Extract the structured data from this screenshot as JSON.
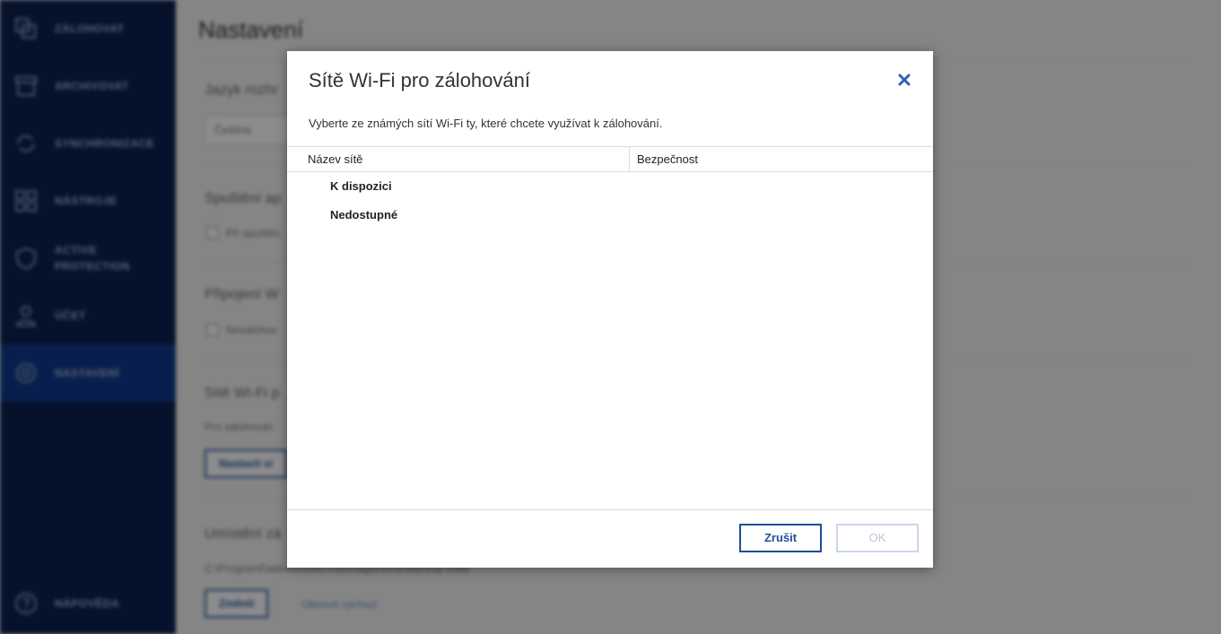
{
  "sidebar": {
    "items": [
      {
        "label": "ZÁLOHOVAT",
        "icon": "copy-icon"
      },
      {
        "label": "ARCHIVOVAT",
        "icon": "archive-icon"
      },
      {
        "label": "SYNCHRONIZACE",
        "icon": "sync-icon"
      },
      {
        "label": "NÁSTROJE",
        "icon": "grid-icon"
      },
      {
        "label": "ACTIVE PROTECTION",
        "icon": "shield-icon"
      },
      {
        "label": "ÚČET",
        "icon": "user-icon"
      },
      {
        "label": "NASTAVENÍ",
        "icon": "gear-icon",
        "active": true
      },
      {
        "label": "NÁPOVĚDA",
        "icon": "help-icon"
      }
    ]
  },
  "main": {
    "title": "Nastavení",
    "sections": {
      "language_title": "Jazyk rozhr",
      "language_value": "Čeština",
      "startup_title": "Spuštění ap",
      "startup_check": "Při spuštěn",
      "connection_title": "Připojení W",
      "connection_check": "Nezálohov",
      "wifi_title": "Sítě Wi-Fi p",
      "wifi_text": "Pro zálohován",
      "wifi_button": "Nastavit sí",
      "location_title": "Umístění zá",
      "location_path": "C:\\ProgramData\\Acronis\\TrueImageHome\\Backup Data",
      "location_button": "Změnit",
      "location_link": "Obnovit výchozí"
    }
  },
  "dialog": {
    "title": "Sítě Wi-Fi pro zálohování",
    "description": "Vyberte ze známých sítí Wi-Fi ty, které chcete využívat k zálohování.",
    "columns": {
      "name": "Název sítě",
      "security": "Bezpečnost"
    },
    "groups": [
      "K dispozici",
      "Nedostupné"
    ],
    "buttons": {
      "cancel": "Zrušit",
      "ok": "OK"
    }
  },
  "colors": {
    "sidebar_bg": "#0b2150",
    "sidebar_active": "#103a8c",
    "accent": "#1e4f9c",
    "ok_disabled": "#c9d6ea"
  }
}
